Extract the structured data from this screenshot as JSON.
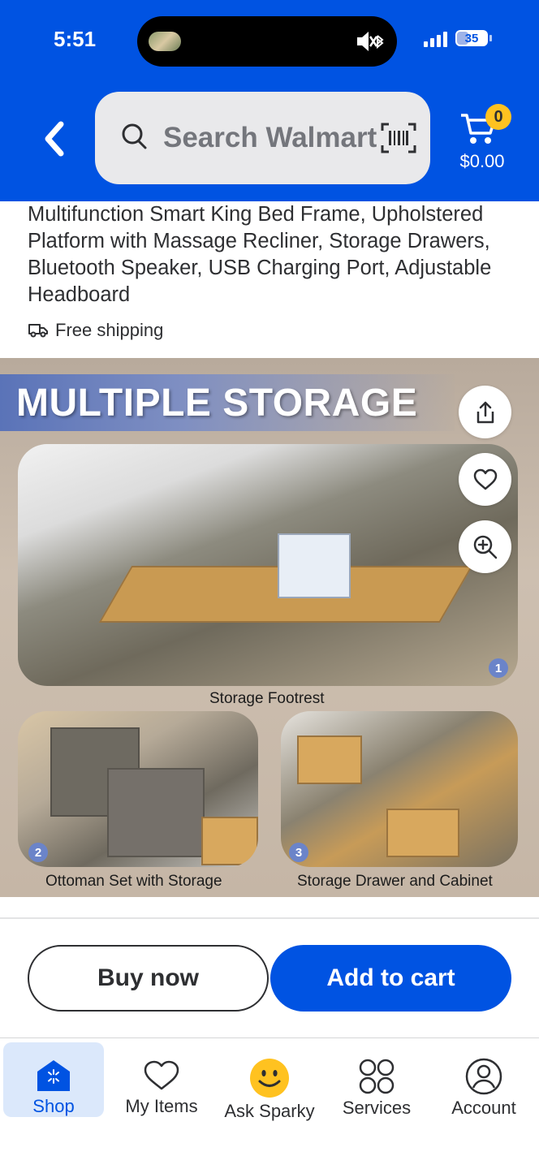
{
  "status_bar": {
    "time": "5:51",
    "battery": "35"
  },
  "header": {
    "back_icon": "chevron-left-icon",
    "search_placeholder": "Search Walmart",
    "cart_count": "0",
    "cart_total": "$0.00"
  },
  "product": {
    "title": "Multifunction Smart King Bed Frame, Upholstered Platform with Massage Recliner, Storage Drawers, Bluetooth Speaker, USB Charging Port, Adjustable Headboard",
    "shipping": "Free shipping"
  },
  "image": {
    "banner": "MULTIPLE STORAGE",
    "captions": [
      "Storage Footrest",
      "Ottoman Set with Storage",
      "Storage Drawer and Cabinet"
    ],
    "numbers": [
      "1",
      "2",
      "3"
    ],
    "actions": [
      "share-icon",
      "heart-icon",
      "zoom-in-icon"
    ]
  },
  "actions": {
    "buy_now": "Buy now",
    "add_to_cart": "Add to cart"
  },
  "nav": {
    "items": [
      {
        "label": "Shop",
        "icon": "walmart-spark-home-icon",
        "active": true
      },
      {
        "label": "My Items",
        "icon": "heart-icon",
        "active": false
      },
      {
        "label": "Ask Sparky",
        "icon": "sparky-smiley-icon",
        "active": false
      },
      {
        "label": "Services",
        "icon": "services-grid-icon",
        "active": false
      },
      {
        "label": "Account",
        "icon": "account-person-icon",
        "active": false
      }
    ]
  },
  "colors": {
    "brand_blue": "#0053e2",
    "badge_yellow": "#ffc220",
    "active_nav_bg": "#dbe8fb"
  }
}
